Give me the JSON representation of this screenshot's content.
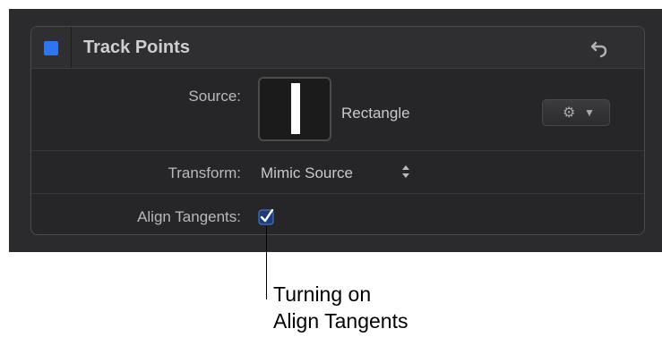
{
  "panel": {
    "title": "Track Points",
    "enabled": true,
    "accent_color": "#2f74f0",
    "reset_icon": "reset-arrow-icon"
  },
  "rows": {
    "source": {
      "label": "Source:",
      "value": "Rectangle",
      "menu_icon": "gear-icon"
    },
    "transform": {
      "label": "Transform:",
      "value": "Mimic Source",
      "icon": "stepper-icon"
    },
    "align_tangents": {
      "label": "Align Tangents:",
      "checked": true
    }
  },
  "callout": {
    "line1": "Turning on",
    "line2": "Align Tangents"
  }
}
